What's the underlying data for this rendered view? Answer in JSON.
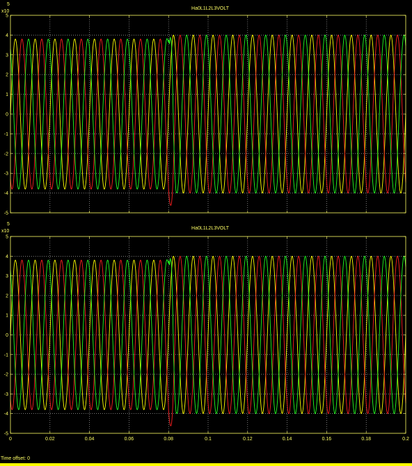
{
  "window": {
    "status_text": "Time offset:  0"
  },
  "colors": {
    "background": "#000000",
    "axes": "#ffff66",
    "grid": "#c8c8c8",
    "phase_a": "#ffff00",
    "phase_b": "#ff2020",
    "phase_c": "#20ff20"
  },
  "chart_data": [
    {
      "type": "line",
      "title": "Ha0L1L2L3VOLT",
      "exponent_label": "x10",
      "exponent_power": "5",
      "xlabel": "",
      "ylabel": "",
      "xlim": [
        0,
        0.2
      ],
      "ylim": [
        -5,
        5
      ],
      "x_ticks": [
        "0",
        "0.02",
        "0.04",
        "0.06",
        "0.08",
        "0.1",
        "0.12",
        "0.14",
        "0.16",
        "0.18",
        "0.2"
      ],
      "y_ticks": [
        "5",
        "4",
        "3",
        "2",
        "1",
        "0",
        "-1",
        "-2",
        "-3",
        "-4",
        "-5"
      ],
      "grid": true,
      "show_x_tick_labels": false,
      "series": [
        {
          "color": "#ffff00",
          "amplitude": 3.8,
          "phase_deg": 0
        },
        {
          "color": "#ff2020",
          "amplitude": 3.8,
          "phase_deg": -120
        },
        {
          "color": "#20ff20",
          "amplitude": 3.8,
          "phase_deg": 120
        }
      ],
      "frequency_hz": 100,
      "transient": {
        "time": 0.08,
        "amplitude_after": 4.0,
        "green_peak": 4.5,
        "red_trough": -4.8
      }
    },
    {
      "type": "line",
      "title": "Ha0L1L2L3VOLT",
      "exponent_label": "x10",
      "exponent_power": "5",
      "xlabel": "",
      "ylabel": "",
      "xlim": [
        0,
        0.2
      ],
      "ylim": [
        -5,
        5
      ],
      "x_ticks": [
        "0",
        "0.02",
        "0.04",
        "0.06",
        "0.08",
        "0.1",
        "0.12",
        "0.14",
        "0.16",
        "0.18",
        "0.2"
      ],
      "y_ticks": [
        "5",
        "4",
        "3",
        "2",
        "1",
        "0",
        "-1",
        "-2",
        "-3",
        "-4",
        "-5"
      ],
      "grid": true,
      "show_x_tick_labels": true,
      "series": [
        {
          "color": "#ffff00",
          "amplitude": 3.8,
          "phase_deg": 0
        },
        {
          "color": "#ff2020",
          "amplitude": 3.8,
          "phase_deg": -120
        },
        {
          "color": "#20ff20",
          "amplitude": 3.8,
          "phase_deg": 120
        }
      ],
      "frequency_hz": 100,
      "transient": {
        "time": 0.08,
        "amplitude_after": 4.0,
        "green_peak": 4.5,
        "red_trough": -4.8
      }
    }
  ]
}
